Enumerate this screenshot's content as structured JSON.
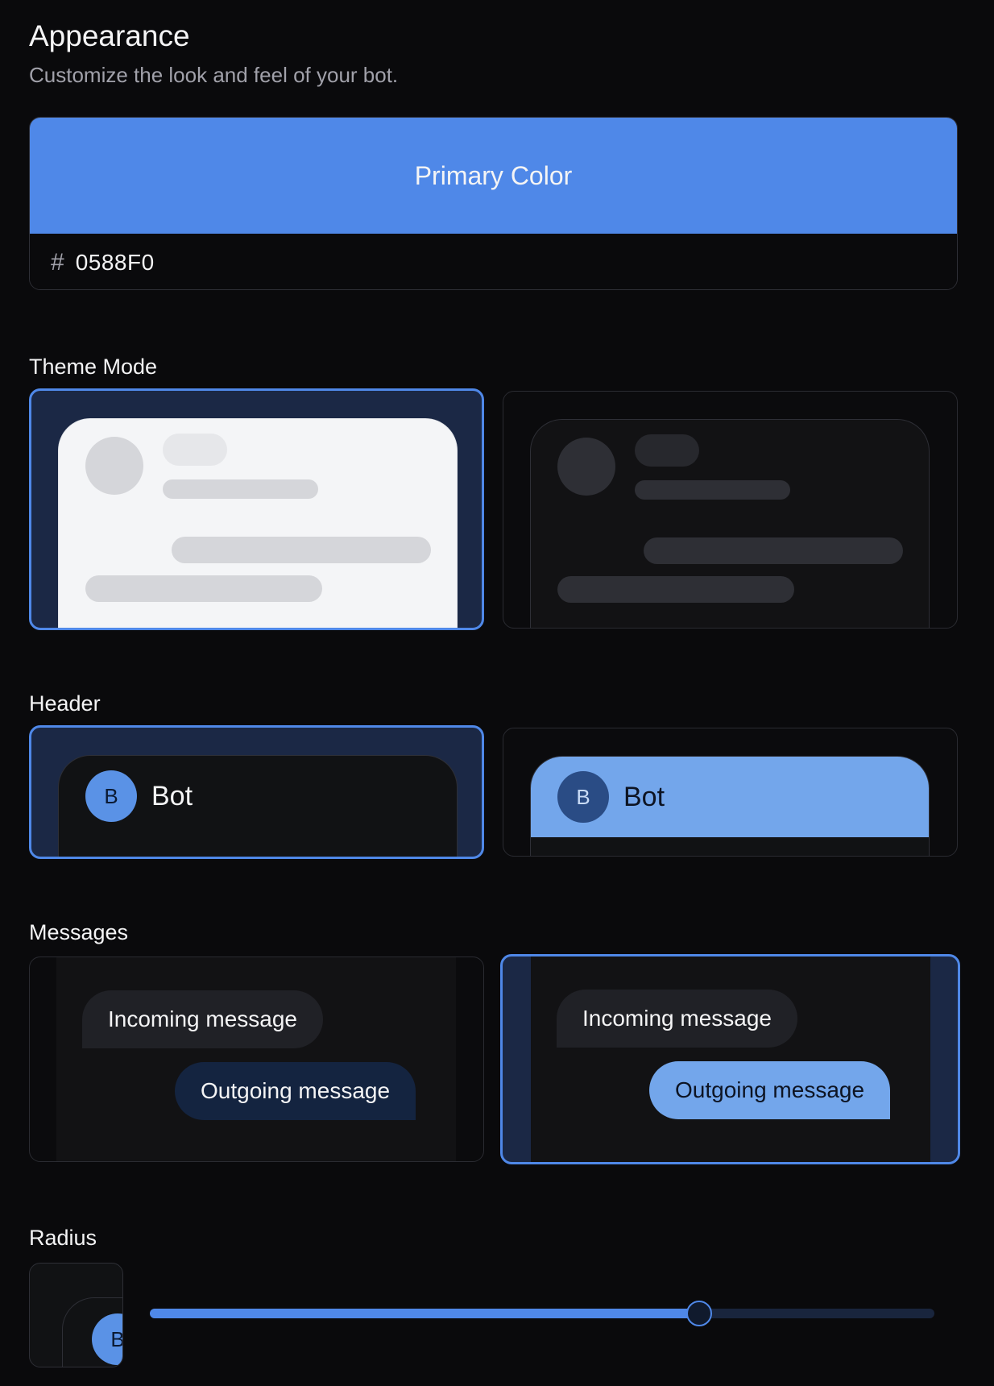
{
  "page": {
    "title": "Appearance",
    "subtitle": "Customize the look and feel of your bot."
  },
  "primary_color": {
    "label": "Primary Color",
    "hash_symbol": "#",
    "value": "0588F0",
    "swatch_color": "#4f88e8"
  },
  "theme_mode": {
    "label": "Theme Mode",
    "options": [
      {
        "id": "light",
        "selected": true
      },
      {
        "id": "dark",
        "selected": false
      }
    ]
  },
  "header": {
    "label": "Header",
    "options": [
      {
        "style": "plain",
        "avatar_letter": "B",
        "name": "Bot",
        "selected": true
      },
      {
        "style": "filled",
        "avatar_letter": "B",
        "name": "Bot",
        "selected": false
      }
    ]
  },
  "messages": {
    "label": "Messages",
    "options": [
      {
        "incoming": "Incoming message",
        "outgoing": "Outgoing message",
        "selected": false
      },
      {
        "incoming": "Incoming message",
        "outgoing": "Outgoing message",
        "selected": true
      }
    ]
  },
  "radius": {
    "label": "Radius",
    "avatar_letter": "B",
    "slider_value_percent": 70
  },
  "colors": {
    "accent": "#4f88e8",
    "selected_bg": "#1b2845",
    "background": "#0a0a0c"
  }
}
